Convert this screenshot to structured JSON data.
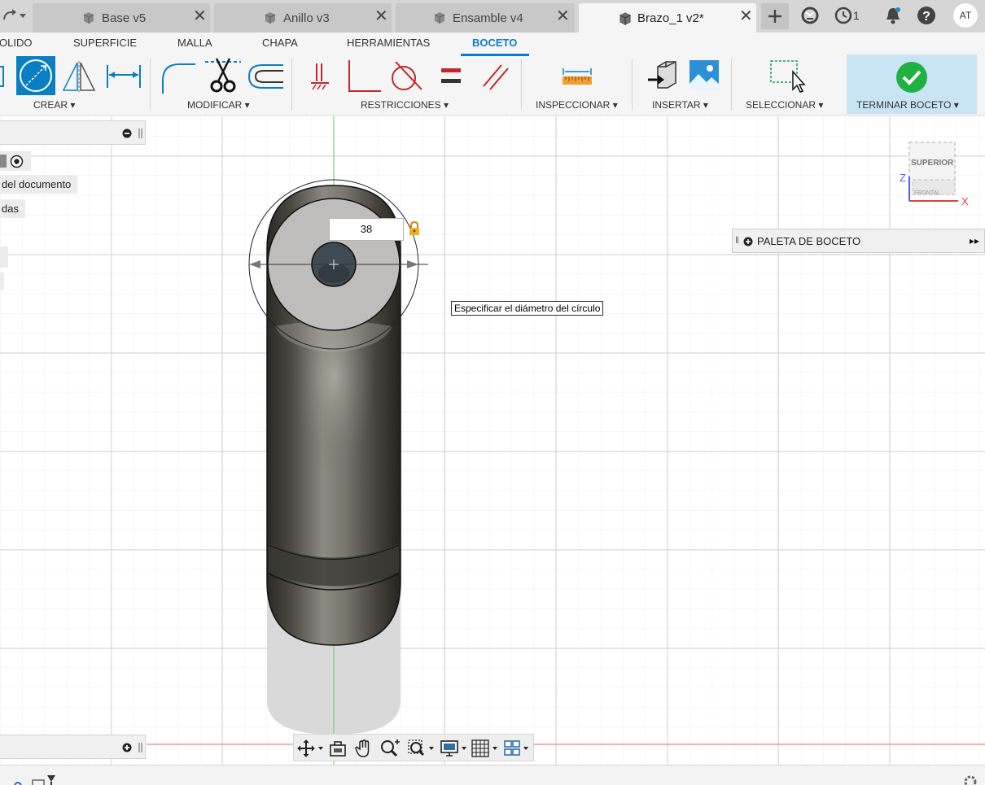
{
  "tabs": [
    {
      "label": "Base v5",
      "active": false
    },
    {
      "label": "Anillo v3",
      "active": false
    },
    {
      "label": "Ensamble v4",
      "active": false
    },
    {
      "label": "Brazo_1 v2*",
      "active": true
    }
  ],
  "header_right": {
    "job_count": "1",
    "user_initials": "AT"
  },
  "ribbon": {
    "tabs": [
      "SÓLIDO",
      "SUPERFICIE",
      "MALLA",
      "CHAPA",
      "HERRAMIENTAS",
      "BOCETO"
    ],
    "visible_tabs": [
      "OLIDO",
      "SUPERFICIE",
      "MALLA",
      "CHAPA",
      "HERRAMIENTAS",
      "BOCETO"
    ],
    "active_tab": "BOCETO",
    "groups": {
      "create": "CREAR",
      "modify": "MODIFICAR",
      "constraints": "RESTRICCIONES",
      "inspect": "INSPECCIONAR",
      "insert": "INSERTAR",
      "select": "SELECCIONAR",
      "finish": "TERMINAR BOCETO"
    }
  },
  "browser": {
    "items": [
      "del documento",
      "das"
    ]
  },
  "sketch": {
    "diameter_value": "38",
    "tooltip": "Especificar el diámetro del círculo"
  },
  "viewcube": {
    "top_label": "SUPERIOR",
    "front_label": "FRONTAL",
    "axis_x": "X",
    "axis_z": "Z"
  },
  "palette": {
    "title": "PALETA DE BOCETO"
  },
  "colors": {
    "accent": "#0a7ec2",
    "finish_green": "#1fb141",
    "constraint_red": "#c0262c",
    "axis_green": "#5ac85a",
    "axis_red": "#e05050"
  }
}
